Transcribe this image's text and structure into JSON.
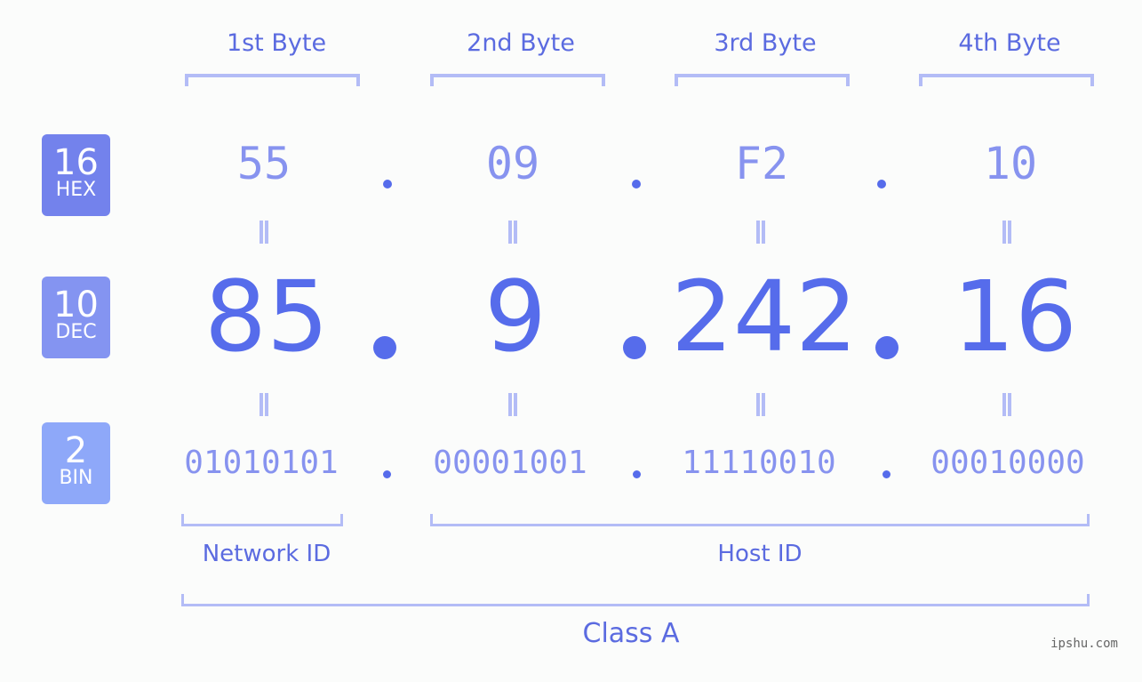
{
  "byte_headers": [
    "1st Byte",
    "2nd Byte",
    "3rd Byte",
    "4th Byte"
  ],
  "badges": {
    "hex": {
      "number": "16",
      "label": "HEX",
      "color": "#7382ec"
    },
    "dec": {
      "number": "10",
      "label": "DEC",
      "color": "#8494f1"
    },
    "bin": {
      "number": "2",
      "label": "BIN",
      "color": "#8ea8f9"
    }
  },
  "ip": {
    "hex": [
      "55",
      "09",
      "F2",
      "10"
    ],
    "dec": [
      "85",
      "9",
      "242",
      "16"
    ],
    "bin": [
      "01010101",
      "00001001",
      "11110010",
      "00010000"
    ]
  },
  "groups": {
    "network_label": "Network ID",
    "host_label": "Host ID",
    "class_label": "Class A"
  },
  "watermark": "ipshu.com",
  "colors": {
    "accent": "#566ceb",
    "light_accent": "#8793ef",
    "bracket": "#b3bcf6",
    "background": "#fbfcfb"
  }
}
